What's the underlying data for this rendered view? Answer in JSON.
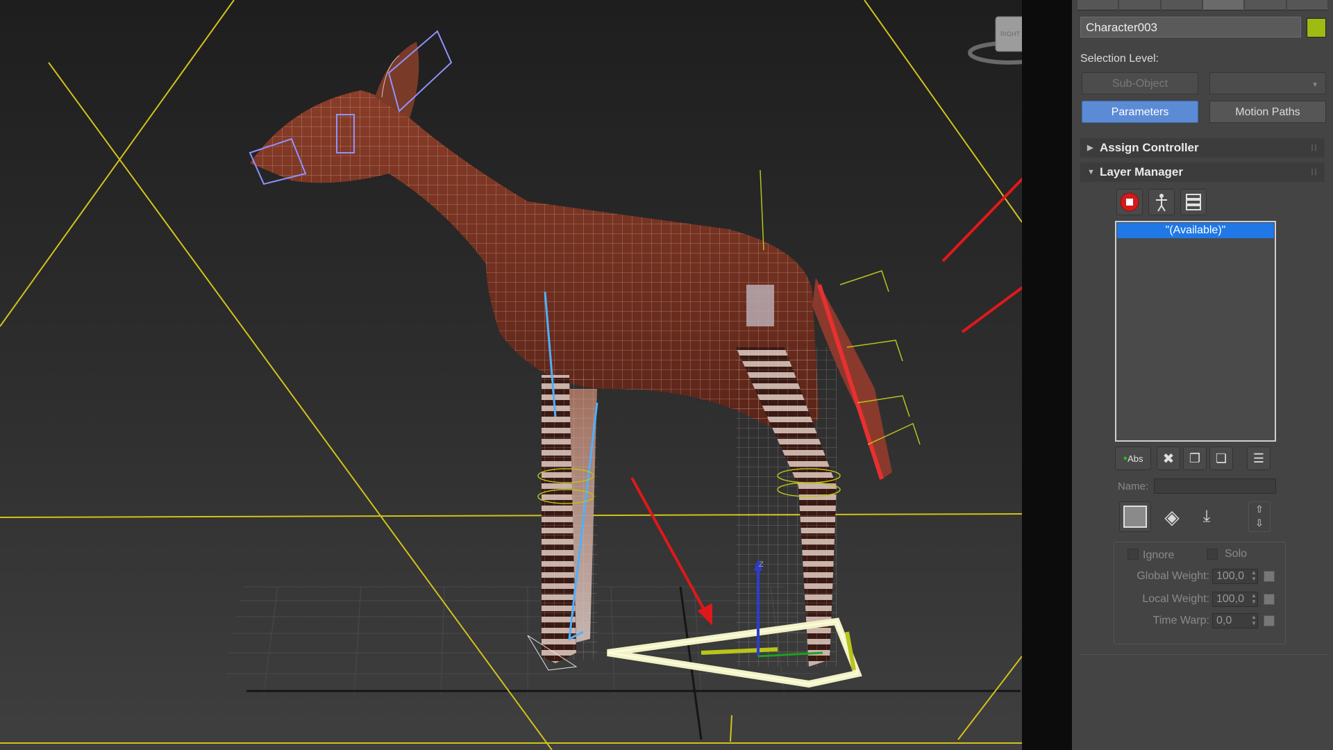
{
  "viewport": {
    "view_cube_label": "RIGHT",
    "gizmo_axis_label": "Z"
  },
  "panel": {
    "object_name": "Character003",
    "object_color": "#9dbb11",
    "selection_level_label": "Selection Level:",
    "sub_object_label": "Sub-Object",
    "parameters_label": "Parameters",
    "motion_paths_label": "Motion Paths",
    "rollouts": {
      "assign_controller": "Assign Controller",
      "layer_manager": "Layer Manager"
    },
    "layer_list": [
      "\"(Available)\""
    ],
    "abs_label": "Abs",
    "name_label": "Name:",
    "ignore_label": "Ignore",
    "solo_label": "Solo",
    "global_weight_label": "Global Weight:",
    "global_weight_value": "100,0",
    "local_weight_label": "Local Weight:",
    "local_weight_value": "100,0",
    "time_warp_label": "Time Warp:",
    "time_warp_value": "0,0"
  },
  "colors": {
    "accent_blue": "#5c8bd6",
    "selection_blue": "#1f78e6",
    "annotation_red": "#e0181a",
    "viewport_border_yellow": "#d4c21a"
  },
  "icons": [
    "record-icon",
    "biped-icon",
    "layer-stack-icon",
    "new-layer-icon",
    "delete-layer-icon",
    "copy-layer-icon",
    "paste-layer-icon",
    "collapse-layer-icon",
    "active-layer-icon",
    "key-icon",
    "save-layer-icon",
    "move-up-icon",
    "move-down-icon"
  ]
}
